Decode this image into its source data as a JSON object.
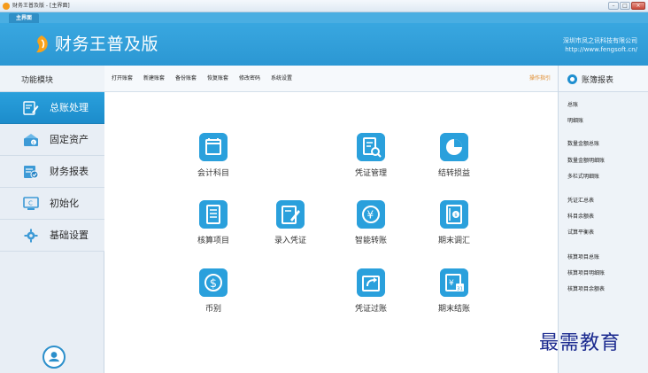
{
  "window": {
    "title": "财务王普及版 - [主界面]",
    "tab_label": "主界面",
    "min_label": "–",
    "max_label": "□",
    "close_label": "×"
  },
  "header": {
    "brand": "财务王普及版",
    "company_name": "深圳市凤之讯科技有限公司",
    "company_url": "http://www.fengsoft.cn/"
  },
  "sidebar": {
    "heading": "功能模块",
    "items": [
      {
        "label": "总账处理",
        "icon": "ledger-pen-icon",
        "active": true
      },
      {
        "label": "固定资产",
        "icon": "fixed-assets-icon",
        "active": false
      },
      {
        "label": "财务报表",
        "icon": "report-check-icon",
        "active": false
      },
      {
        "label": "初始化",
        "icon": "init-monitor-icon",
        "active": false
      },
      {
        "label": "基础设置",
        "icon": "gear-icon",
        "active": false
      }
    ]
  },
  "toolbar": {
    "links": [
      "打开账套",
      "新建账套",
      "备份账套",
      "恢复账套",
      "修改密码",
      "系统设置"
    ],
    "help": "操作指引"
  },
  "main": {
    "tiles": [
      {
        "label": "会计科目",
        "icon": "calendar-icon"
      },
      {
        "label": "凭证管理",
        "icon": "voucher-search-icon"
      },
      {
        "label": "结转损益",
        "icon": "pie-chart-icon"
      },
      {
        "label": "核算项目",
        "icon": "document-list-icon"
      },
      {
        "label": "录入凭证",
        "icon": "edit-document-icon"
      },
      {
        "label": "智能转账",
        "icon": "yen-transfer-icon"
      },
      {
        "label": "期末调汇",
        "icon": "exchange-book-icon"
      },
      {
        "label": "币别",
        "icon": "dollar-coin-icon"
      },
      {
        "label": "凭证过账",
        "icon": "posting-arrow-icon"
      },
      {
        "label": "期末结账",
        "icon": "yen-calendar-icon"
      }
    ]
  },
  "right_panel": {
    "heading": "账簿报表",
    "links": [
      "总账",
      "明细账",
      "数量金额总账",
      "数量金额明细账",
      "多栏式明细账",
      "凭证汇总表",
      "科目余额表",
      "试算平衡表",
      "核算项目总账",
      "核算项目明细账",
      "核算项目余额表"
    ]
  },
  "watermark": "最需教育",
  "colors": {
    "accent": "#2aa0dc",
    "banner": "#39a7e0",
    "help": "#e08a2a"
  }
}
